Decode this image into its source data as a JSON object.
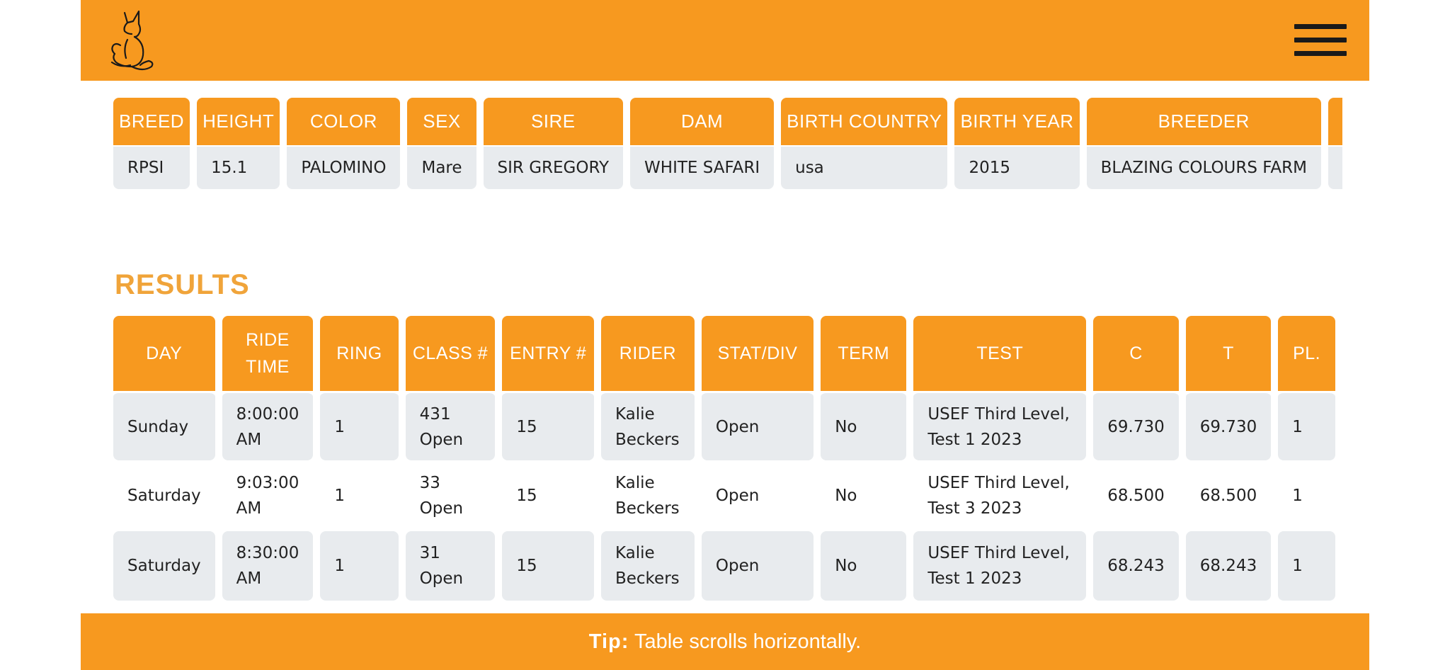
{
  "header": {
    "logo_icon": "fox-logo-icon",
    "menu_icon": "hamburger-menu-icon"
  },
  "details": {
    "columns": [
      "BREED",
      "HEIGHT",
      "COLOR",
      "SEX",
      "SIRE",
      "DAM",
      "BIRTH COUNTRY",
      "BIRTH YEAR",
      "BREEDER"
    ],
    "values": [
      "RPSI",
      "15.1",
      "PALOMINO",
      "Mare",
      "SIR GREGORY",
      "WHITE SAFARI",
      "usa",
      "2015",
      "BLAZING COLOURS FARM"
    ]
  },
  "results": {
    "title": "RESULTS",
    "columns": {
      "day": "DAY",
      "ride_time": "RIDE TIME",
      "ring": "RING",
      "class": "CLASS #",
      "entry": "ENTRY #",
      "rider": "RIDER",
      "stat_div": "STAT/DIV",
      "term": "TERM",
      "test": "TEST",
      "c": "C",
      "t": "T",
      "place": "PL."
    },
    "rows": [
      {
        "day": "Sunday",
        "ride_time": "8:00:00 AM",
        "ring": "1",
        "class": "431 Open",
        "entry": "15",
        "rider": "Kalie Beckers",
        "stat_div": "Open",
        "term": "No",
        "test": "USEF Third Level, Test 1 2023",
        "c": "69.730",
        "t": "69.730",
        "place": "1"
      },
      {
        "day": "Saturday",
        "ride_time": "9:03:00 AM",
        "ring": "1",
        "class": "33 Open",
        "entry": "15",
        "rider": "Kalie Beckers",
        "stat_div": "Open",
        "term": "No",
        "test": "USEF Third Level, Test 3 2023",
        "c": "68.500",
        "t": "68.500",
        "place": "1"
      },
      {
        "day": "Saturday",
        "ride_time": "8:30:00 AM",
        "ring": "1",
        "class": "31 Open",
        "entry": "15",
        "rider": "Kalie Beckers",
        "stat_div": "Open",
        "term": "No",
        "test": "USEF Third Level, Test 1 2023",
        "c": "68.243",
        "t": "68.243",
        "place": "1"
      }
    ]
  },
  "tip": {
    "label": "Tip:",
    "text": "Table scrolls horizontally."
  },
  "colors": {
    "brand_orange": "#f7991f",
    "title_orange": "#f0a43a",
    "cell_gray": "#e8ebee",
    "link_teal": "#1f7a8c"
  }
}
